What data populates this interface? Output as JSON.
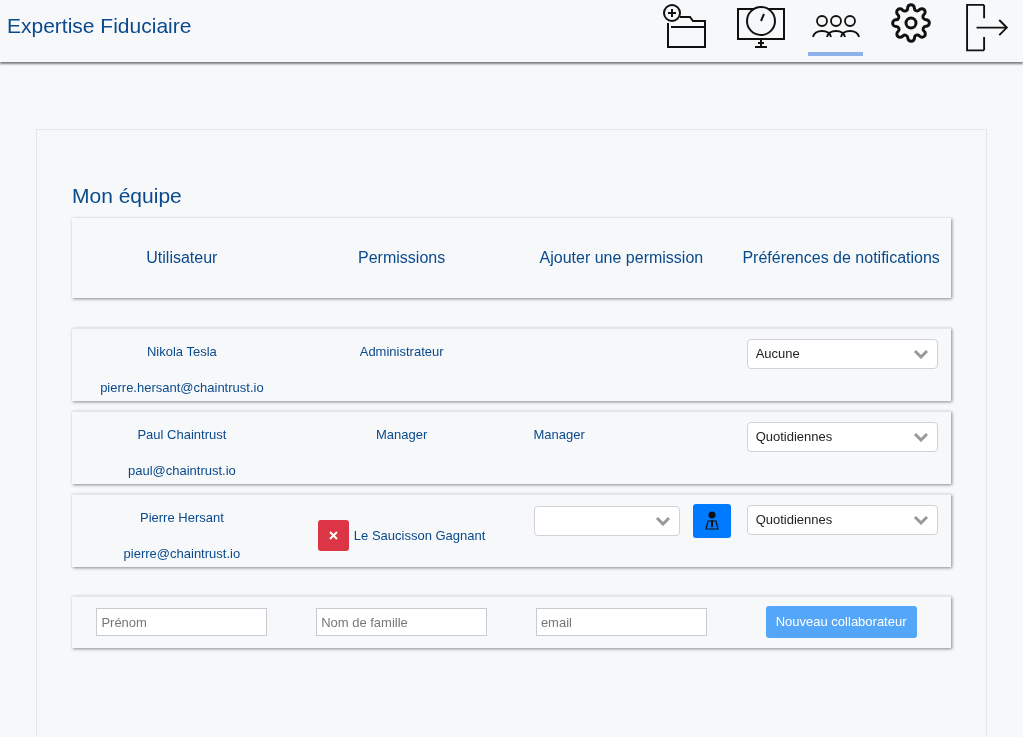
{
  "app_title": "Expertise Fiduciaire",
  "nav": [
    {
      "kind": "new-folder",
      "selected": false
    },
    {
      "kind": "dashboard",
      "selected": false
    },
    {
      "kind": "team",
      "selected": true
    },
    {
      "kind": "settings",
      "selected": false
    },
    {
      "kind": "logout",
      "selected": false
    }
  ],
  "section_title": "Mon équipe",
  "columns": [
    "Utilisateur",
    "Permissions",
    "Ajouter une permission",
    "Préférences de notifications"
  ],
  "rows": [
    {
      "name": "Nikola Tesla",
      "email": "pierre.hersant@chaintrust.io",
      "permission": {
        "label": "Administrateur",
        "removable": false
      },
      "add_permission": {
        "kind": "none"
      },
      "notifications": "Aucune"
    },
    {
      "name": "Paul Chaintrust",
      "email": "paul@chaintrust.io",
      "permission": {
        "label": "Manager",
        "removable": false
      },
      "add_permission": {
        "kind": "text",
        "text": "Manager"
      },
      "notifications": "Quotidiennes"
    },
    {
      "name": "Pierre Hersant",
      "email": "pierre@chaintrust.io",
      "permission": {
        "label": "Le Saucisson Gagnant",
        "removable": true
      },
      "add_permission": {
        "kind": "select"
      },
      "notifications": "Quotidiennes"
    }
  ],
  "new_member": {
    "first_name_placeholder": "Prénom",
    "last_name_placeholder": "Nom de famille",
    "email_placeholder": "email",
    "button": "Nouveau collaborateur"
  }
}
